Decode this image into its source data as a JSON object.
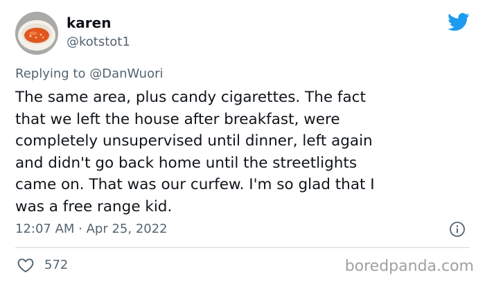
{
  "tweet": {
    "author_name": "karen",
    "author_handle": "@kotstot1",
    "reply_prefix": "Replying to",
    "reply_to": "@DanWuori",
    "body_lines": [
      "The same area, plus candy cigarettes. The fact",
      "that we left the house after breakfast, were",
      "completely unsupervised until dinner, left again",
      "and didn't go back home until the streetlights",
      "came on. That was our curfew. I'm so glad that I",
      "was a free range kid."
    ],
    "timestamp": "12:07 AM · Apr 25, 2022",
    "like_count": "572"
  },
  "icons": {
    "brand": "twitter-bird-icon",
    "info": "info-icon",
    "like": "heart-icon"
  },
  "watermark": "boredpanda.com",
  "colors": {
    "brand_blue": "#1d9bf0",
    "text_primary": "#0f1419",
    "text_secondary": "#536471",
    "divider": "#cfd9de"
  }
}
